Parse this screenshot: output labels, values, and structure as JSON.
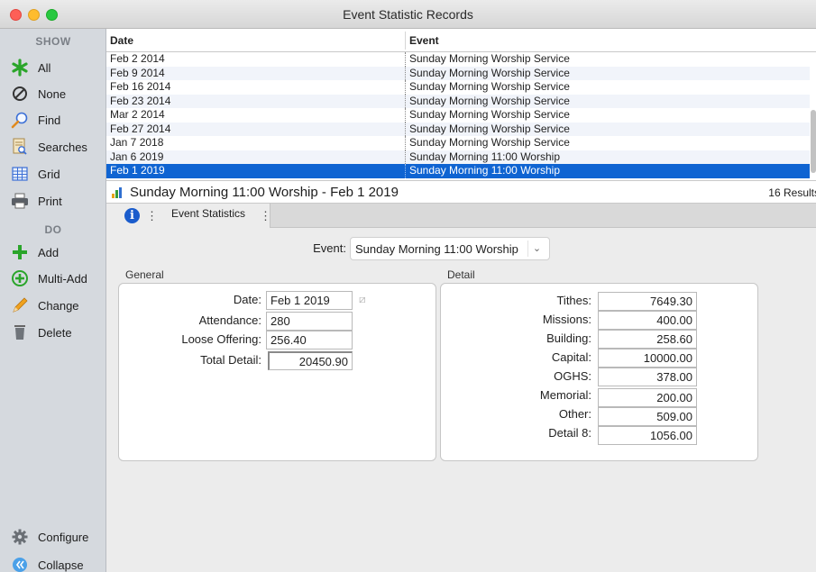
{
  "window": {
    "title": "Event Statistic Records"
  },
  "sidebar": {
    "show_heading": "SHOW",
    "do_heading": "DO",
    "show_items": [
      {
        "label": "All",
        "icon": "asterisk-icon"
      },
      {
        "label": "None",
        "icon": "none-icon"
      },
      {
        "label": "Find",
        "icon": "magnifier-icon"
      },
      {
        "label": "Searches",
        "icon": "saved-search-icon"
      },
      {
        "label": "Grid",
        "icon": "grid-icon"
      },
      {
        "label": "Print",
        "icon": "printer-icon"
      }
    ],
    "do_items": [
      {
        "label": "Add",
        "icon": "plus-icon"
      },
      {
        "label": "Multi-Add",
        "icon": "multi-add-icon"
      },
      {
        "label": "Change",
        "icon": "pencil-icon"
      },
      {
        "label": "Delete",
        "icon": "trash-icon"
      }
    ],
    "bottom_items": [
      {
        "label": "Configure",
        "icon": "gear-icon"
      },
      {
        "label": "Collapse",
        "icon": "collapse-icon"
      }
    ]
  },
  "list": {
    "columns": [
      "Date",
      "Event"
    ],
    "rows": [
      {
        "date": "Feb 2 2014",
        "event": "Sunday Morning Worship Service"
      },
      {
        "date": "Feb 9 2014",
        "event": "Sunday Morning Worship Service"
      },
      {
        "date": "Feb 16 2014",
        "event": "Sunday Morning Worship Service"
      },
      {
        "date": "Feb 23 2014",
        "event": "Sunday Morning Worship Service"
      },
      {
        "date": "Mar 2 2014",
        "event": "Sunday Morning Worship Service"
      },
      {
        "date": "Feb 27 2014",
        "event": "Sunday Morning Worship Service"
      },
      {
        "date": "Jan 7 2018",
        "event": "Sunday Morning Worship Service"
      },
      {
        "date": "Jan 6 2019",
        "event": "Sunday Morning 11:00 Worship"
      },
      {
        "date": "Feb 1 2019",
        "event": "Sunday Morning 11:00 Worship"
      }
    ],
    "selected_index": 8
  },
  "summary": {
    "title": "Sunday Morning 11:00 Worship - Feb 1 2019",
    "count": "16 Results",
    "icon_colors": [
      "#e8a317",
      "#3a9d3a",
      "#2f6fd0"
    ]
  },
  "tabs": {
    "dots": "⋮",
    "items": [
      "Event Statistics"
    ]
  },
  "form": {
    "event_label": "Event:",
    "event_value": "Sunday Morning 11:00 Worship",
    "general_label": "General",
    "detail_label": "Detail",
    "general": [
      {
        "label": "Date:",
        "value": "Feb 1 2019"
      },
      {
        "label": "Attendance:",
        "value": "280"
      },
      {
        "label": "Loose Offering:",
        "value": "256.40"
      },
      {
        "label": "Total Detail:",
        "value": "20450.90"
      }
    ],
    "detail": [
      {
        "label": "Tithes:",
        "value": "7649.30"
      },
      {
        "label": "Missions:",
        "value": "400.00"
      },
      {
        "label": "Building:",
        "value": "258.60"
      },
      {
        "label": "Capital:",
        "value": "10000.00"
      },
      {
        "label": "OGHS:",
        "value": "378.00"
      },
      {
        "label": "Memorial:",
        "value": "200.00"
      },
      {
        "label": "Other:",
        "value": "509.00"
      },
      {
        "label": "Detail 8:",
        "value": "1056.00"
      }
    ]
  },
  "colors": {
    "selection": "#0f64d2",
    "add_green": "#2aa52a",
    "info_blue": "#1a5ccc"
  }
}
